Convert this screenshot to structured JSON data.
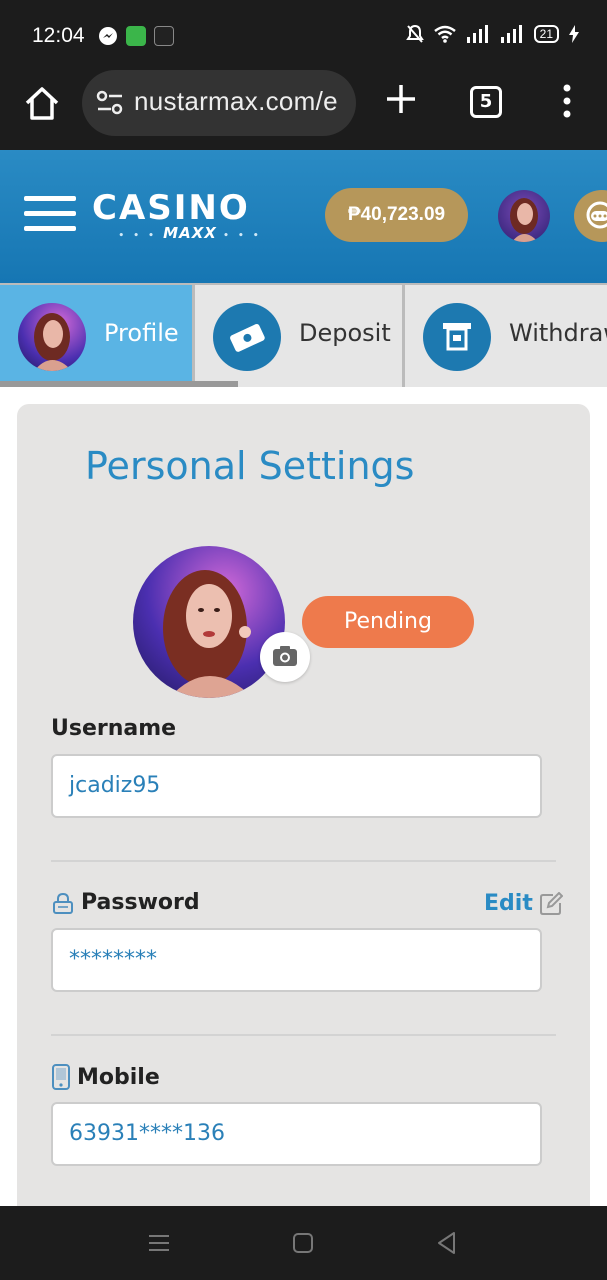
{
  "status_bar": {
    "time": "12:04",
    "battery": "21"
  },
  "browser": {
    "url": "nustarmax.com/e",
    "tab_count": "5"
  },
  "header": {
    "logo_main": "CASINO",
    "logo_sub": "MAXX",
    "balance": "₱40,723.09"
  },
  "nav_tabs": [
    {
      "label": "Profile",
      "active": true
    },
    {
      "label": "Deposit",
      "active": false
    },
    {
      "label": "Withdraw",
      "active": false
    }
  ],
  "settings": {
    "title": "Personal Settings",
    "status_badge": "Pending",
    "username_label": "Username",
    "username_value": "jcadiz95",
    "password_label": "Password",
    "edit_label": "Edit",
    "password_value": "********",
    "mobile_label": "Mobile",
    "mobile_value": "63931****136"
  },
  "colors": {
    "primary": "#2a8bc4",
    "gold": "#b6975a",
    "pending": "#ee7a4c",
    "active_tab": "#5ab4e4"
  }
}
